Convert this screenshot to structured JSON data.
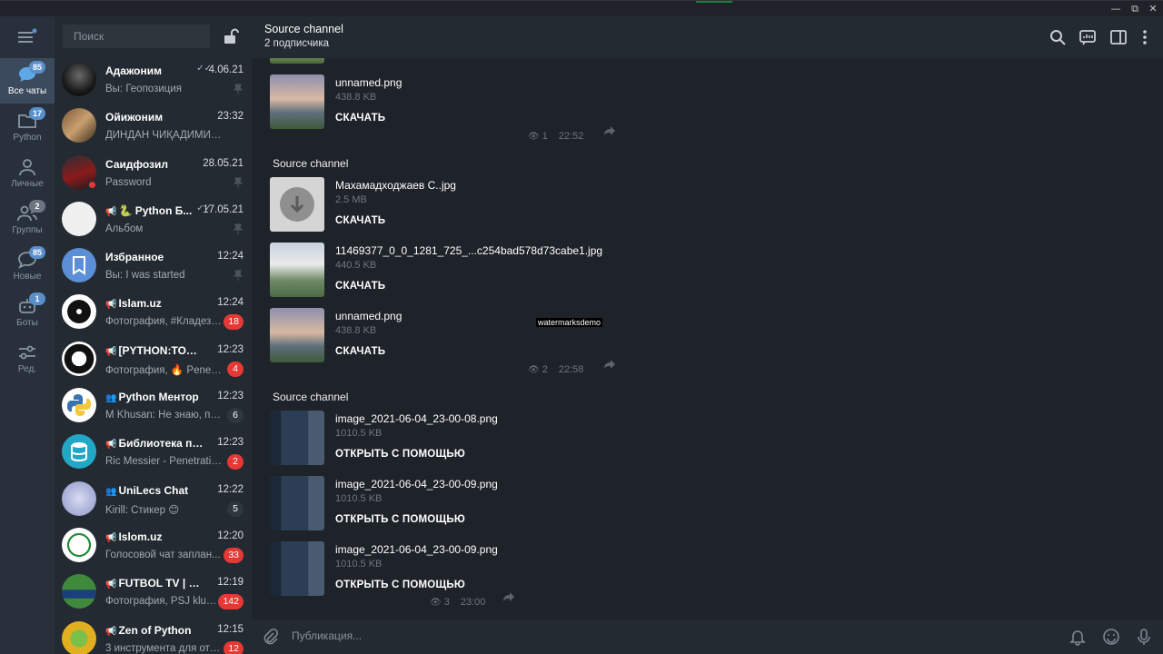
{
  "window": {
    "minimize": "—",
    "restore": "⧉",
    "close": "✕"
  },
  "rail": {
    "items": [
      {
        "label": "Все чаты",
        "badge": "85",
        "icon": "chats-icon"
      },
      {
        "label": "Python",
        "badge": "17",
        "icon": "folder-icon"
      },
      {
        "label": "Личные",
        "badge": "",
        "icon": "person-icon"
      },
      {
        "label": "Группы",
        "badge": "2",
        "icon": "group-icon"
      },
      {
        "label": "Новые",
        "badge": "85",
        "icon": "new-chat-icon"
      },
      {
        "label": "Боты",
        "badge": "1",
        "icon": "bot-icon"
      },
      {
        "label": "Ред.",
        "badge": "",
        "icon": "edit-filters-icon"
      }
    ]
  },
  "chatlist": {
    "search_placeholder": "Поиск",
    "chats": [
      {
        "name": "Адажоним",
        "time": "4.06.21",
        "preview": "Вы: Геопозиция",
        "badge": "",
        "pinned": true,
        "check": "✓✓",
        "channel": false,
        "group": false
      },
      {
        "name": "Ойижоним",
        "time": "23:32",
        "preview": "ДИНДАН ЧИҚАДИМИ ...",
        "badge": "",
        "pinned": false,
        "check": "",
        "channel": false,
        "group": false
      },
      {
        "name": "Саидфозил",
        "time": "28.05.21",
        "preview": "Password",
        "badge": "",
        "pinned": true,
        "check": "",
        "channel": false,
        "group": false
      },
      {
        "name": "🐍 Python Б...",
        "time": "17.05.21",
        "preview": "Альбом",
        "badge": "",
        "pinned": true,
        "check": "✓✓",
        "channel": true,
        "group": false
      },
      {
        "name": "Избранное",
        "time": "12:24",
        "preview": "Вы: I was started",
        "badge": "",
        "pinned": true,
        "check": "",
        "channel": false,
        "group": false
      },
      {
        "name": "Islam.uz",
        "time": "12:24",
        "preview": "Фотография, #Кладезь...",
        "badge": "18",
        "pinned": false,
        "check": "",
        "channel": true,
        "group": false
      },
      {
        "name": "[PYTHON:TODAY]",
        "time": "12:23",
        "preview": "Фотография, 🔥 Penetr...",
        "badge": "4",
        "pinned": false,
        "check": "",
        "channel": true,
        "group": false
      },
      {
        "name": "Python Ментор",
        "time": "12:23",
        "preview": "M Khusan: Не знаю, поч...",
        "badge": "6",
        "pinned": false,
        "check": "",
        "channel": false,
        "group": true,
        "muted": true
      },
      {
        "name": "Библиотека прог...",
        "time": "12:23",
        "preview": "Ric Messier - Penetratio...",
        "badge": "2",
        "pinned": false,
        "check": "",
        "channel": true,
        "group": false
      },
      {
        "name": "UniLecs Chat",
        "time": "12:22",
        "preview": "Kirill: Стикер 😊",
        "badge": "5",
        "pinned": false,
        "check": "",
        "channel": false,
        "group": true,
        "muted": true
      },
      {
        "name": "Islom.uz",
        "time": "12:20",
        "preview": "Голосовой чат заплан...",
        "badge": "33",
        "pinned": false,
        "check": "",
        "channel": true,
        "group": false
      },
      {
        "name": "FUTBOL TV | RAS...",
        "time": "12:19",
        "preview": "Фотография, PSJ klubi...",
        "badge": "142",
        "pinned": false,
        "check": "",
        "channel": true,
        "group": false
      },
      {
        "name": "Zen of Python",
        "time": "12:15",
        "preview": "3 инструмента для отс...",
        "badge": "12",
        "pinned": false,
        "check": "",
        "channel": true,
        "group": false
      }
    ]
  },
  "header": {
    "title": "Source channel",
    "subtitle": "2 подписчика"
  },
  "messages": {
    "groups": [
      {
        "sender": "",
        "files": [
          {
            "name": "unnamed.png",
            "size": "438.8 KB",
            "action": "СКАЧАТЬ"
          }
        ],
        "views": "1",
        "time": "22:52"
      },
      {
        "sender": "Source channel",
        "files": [
          {
            "name": "Махамадходжаев С..jpg",
            "size": "2.5 MB",
            "action": "СКАЧАТЬ"
          },
          {
            "name": "11469377_0_0_1281_725_...c254bad578d73cabe1.jpg",
            "size": "440.5 KB",
            "action": "СКАЧАТЬ"
          },
          {
            "name": "unnamed.png",
            "size": "438.8 KB",
            "action": "СКАЧАТЬ"
          }
        ],
        "views": "2",
        "time": "22:58"
      },
      {
        "sender": "Source channel",
        "files": [
          {
            "name": "image_2021-06-04_23-00-08.png",
            "size": "1010.5 KB",
            "action": "ОТКРЫТЬ С ПОМОЩЬЮ"
          },
          {
            "name": "image_2021-06-04_23-00-09.png",
            "size": "1010.5 KB",
            "action": "ОТКРЫТЬ С ПОМОЩЬЮ"
          },
          {
            "name": "image_2021-06-04_23-00-09.png",
            "size": "1010.5 KB",
            "action": "ОТКРЫТЬ С ПОМОЩЬЮ"
          }
        ],
        "views": "3",
        "time": "23:00"
      }
    ],
    "watermark": "watermarksdemo"
  },
  "composer": {
    "placeholder": "Публикация..."
  },
  "colors": {
    "accent": "#5a8fcc",
    "unread": "#e53935",
    "rail": "#28303c",
    "list": "#242a31",
    "main": "#1e2229"
  }
}
